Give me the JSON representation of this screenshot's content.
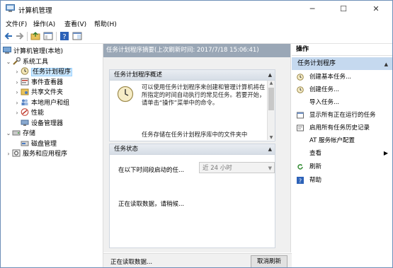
{
  "window": {
    "title": "计算机管理",
    "minimize": "─",
    "maximize": "☐",
    "close": "✕"
  },
  "menu": [
    "文件(F)",
    "操作(A)",
    "查看(V)",
    "帮助(H)"
  ],
  "tree": {
    "root": "计算机管理(本地)",
    "system_tools": "系统工具",
    "task_scheduler": "任务计划程序",
    "event_viewer": "事件查看器",
    "shared_folders": "共享文件夹",
    "local_users": "本地用户和组",
    "performance": "性能",
    "device_manager": "设备管理器",
    "storage": "存储",
    "disk_management": "磁盘管理",
    "services_apps": "服务和应用程序"
  },
  "center": {
    "header": "任务计划程序摘要(上次刷新时间: 2017/7/18 15:06:41)",
    "overview_title": "任务计划程序概述",
    "overview_text": "可以使用任务计划程序来创建和管理计算机将在所指定的时间自动执行的常见任务。若要开始，请单击“操作”菜单中的命令。",
    "overview_more": "任务存储在任务计划程序库中的文件夹中",
    "status_title": "任务状态",
    "period_label": "在以下时间段启动的任...",
    "period_value": "近 24 小时",
    "reading": "正在读取数据，请稍候..."
  },
  "statusbar": {
    "text": "正在读取数据...",
    "cancel": "取消刷新"
  },
  "actions": {
    "header": "操作",
    "subheader": "任务计划程序",
    "items": [
      "创建基本任务...",
      "创建任务...",
      "导入任务...",
      "显示所有正在运行的任务",
      "启用所有任务历史记录",
      "AT 服务帐户配置",
      "查看",
      "刷新",
      "帮助"
    ]
  },
  "colors": {
    "header_bar": "#9aa7b6",
    "selection": "#cce8ff",
    "action_sub": "#c5d9ef"
  }
}
